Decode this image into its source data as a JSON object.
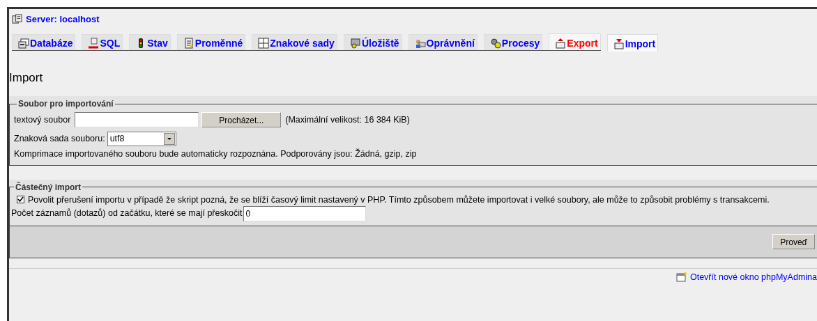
{
  "server": {
    "label": "Server: localhost"
  },
  "tabs": [
    {
      "label": "Databáze",
      "selected": false,
      "hovered": false
    },
    {
      "label": "SQL",
      "selected": false,
      "hovered": false
    },
    {
      "label": "Stav",
      "selected": false,
      "hovered": false
    },
    {
      "label": "Proměnné",
      "selected": false,
      "hovered": false
    },
    {
      "label": "Znakové sady",
      "selected": false,
      "hovered": false
    },
    {
      "label": "Úložiště",
      "selected": false,
      "hovered": false
    },
    {
      "label": "Oprávnění",
      "selected": false,
      "hovered": false
    },
    {
      "label": "Procesy",
      "selected": false,
      "hovered": false
    },
    {
      "label": "Export",
      "selected": false,
      "hovered": true
    },
    {
      "label": "Import",
      "selected": true,
      "hovered": false
    }
  ],
  "heading": "Import",
  "file_section": {
    "legend": "Soubor pro importování",
    "file_label": "textový soubor",
    "browse_button": "Procházet...",
    "max_size": "(Maximální velikost: 16 384 KiB)",
    "charset_label": "Znaková sada souboru:",
    "charset_value": "utf8",
    "compression_note": "Komprimace importovaného souboru bude automaticky rozpoznána. Podporovány jsou: Žádná, gzip, zip"
  },
  "partial_section": {
    "legend": "Částečný import",
    "allow_interrupt": {
      "label": "Povolit přerušení importu v případě že skript pozná, že se blíží časový limit nastavený v PHP. Tímto způsobem můžete importovat i velké soubory, ale může to způsobit problémy s transakcemi.",
      "checked": true
    },
    "skip_label": "Počet záznamů (dotazů) od začátku, které se mají přeskočit",
    "skip_value": "0"
  },
  "submit_button": "Proveď",
  "footer_link": "Otevřít nové okno phpMyAdmina"
}
